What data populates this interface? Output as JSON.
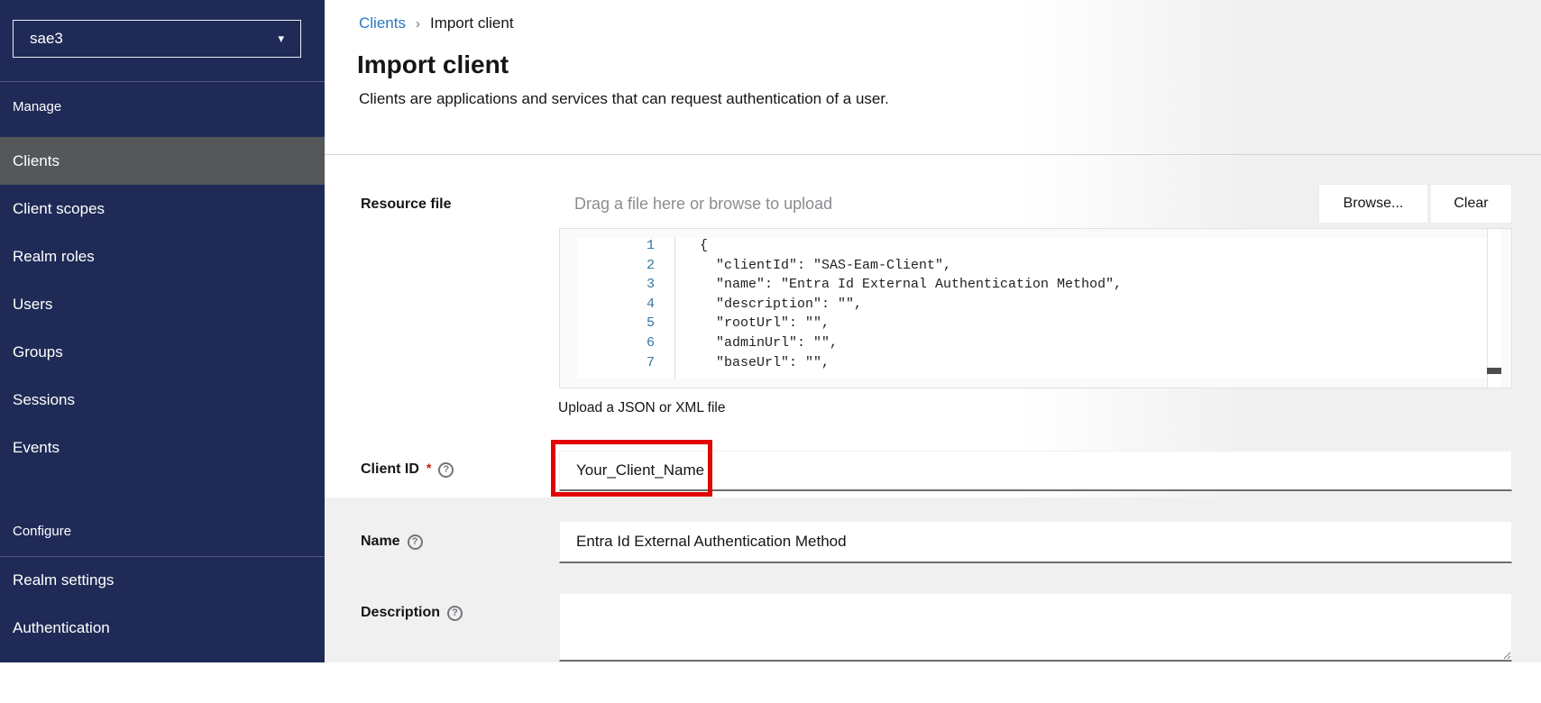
{
  "sidebar": {
    "realm": "sae3",
    "manage_label": "Manage",
    "manage_items": [
      "Clients",
      "Client scopes",
      "Realm roles",
      "Users",
      "Groups",
      "Sessions",
      "Events"
    ],
    "selected_item": "Clients",
    "configure_label": "Configure",
    "configure_items": [
      "Realm settings",
      "Authentication"
    ]
  },
  "breadcrumb": {
    "link": "Clients",
    "separator": "›",
    "current": "Import client"
  },
  "header": {
    "title": "Import client",
    "subtitle": "Clients are applications and services that can request authentication of a user."
  },
  "form": {
    "resource_file": {
      "label": "Resource file",
      "placeholder": "Drag a file here or browse to upload",
      "browse_label": "Browse...",
      "clear_label": "Clear",
      "helper": "Upload a JSON or XML file",
      "code_lines": [
        {
          "num": "1",
          "text": "{"
        },
        {
          "num": "2",
          "text": "  \"clientId\": \"SAS-Eam-Client\","
        },
        {
          "num": "3",
          "text": "  \"name\": \"Entra Id External Authentication Method\","
        },
        {
          "num": "4",
          "text": "  \"description\": \"\","
        },
        {
          "num": "5",
          "text": "  \"rootUrl\": \"\","
        },
        {
          "num": "6",
          "text": "  \"adminUrl\": \"\","
        },
        {
          "num": "7",
          "text": "  \"baseUrl\": \"\","
        }
      ]
    },
    "client_id": {
      "label": "Client ID",
      "required_marker": "*",
      "value": "Your_Client_Name"
    },
    "name": {
      "label": "Name",
      "value": "Entra Id External Authentication Method"
    },
    "description": {
      "label": "Description",
      "value": ""
    }
  },
  "icons": {
    "realm_caret": "▾",
    "help": "?"
  },
  "colors": {
    "sidebar_navy": "#1f2b56",
    "selected_item_gray": "#54585a",
    "breadcrumb_link_blue": "#2b77c0",
    "annotation_red": "#e00500",
    "required_red": "#c9190b",
    "line_number_blue": "#36749f",
    "placeholder_gray": "#8a8d90"
  }
}
